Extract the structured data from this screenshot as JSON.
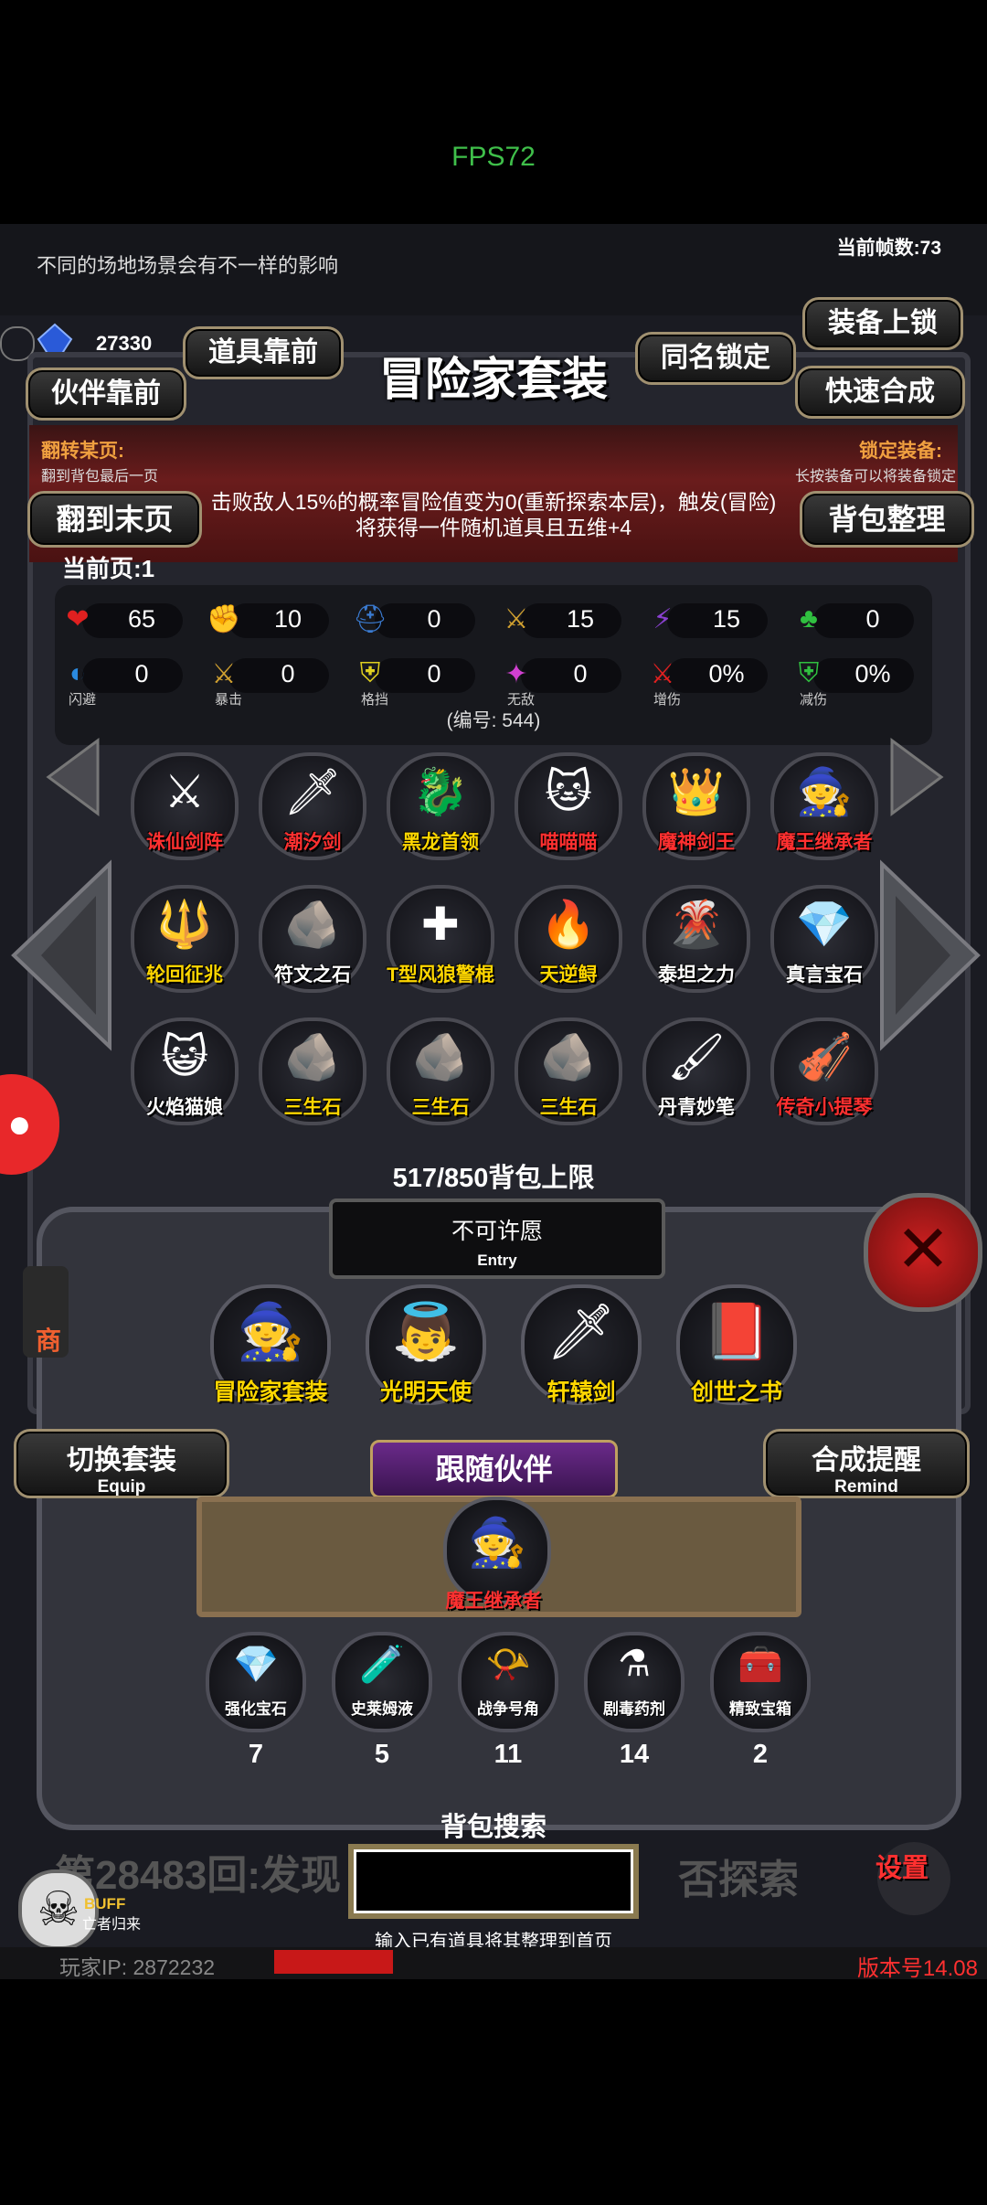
{
  "fps": "FPS72",
  "top_hint": "不同的场地场景会有不一样的影响",
  "frame_count": "当前帧数:73",
  "currency": "27330",
  "buttons": {
    "items_front": "道具靠前",
    "partner_front": "伙伴靠前",
    "same_name_lock": "同名锁定",
    "equip_lock": "装备上锁",
    "quick_synth": "快速合成",
    "last_page": "翻到末页",
    "bag_sort": "背包整理",
    "switch_set": "切换套装",
    "switch_set_en": "Equip",
    "synth_remind": "合成提醒",
    "synth_remind_en": "Remind",
    "follow_partner": "跟随伙伴",
    "settings": "设置",
    "shop_partial": "商"
  },
  "panel_title": "冒险家套装",
  "flip_page_label": "翻转某页:",
  "flip_page_hint": "翻到背包最后一页",
  "lock_equip_label": "锁定装备:",
  "lock_equip_hint": "长按装备可以将装备锁定",
  "description": "击败敌人15%的概率冒险值变为0(重新探索本层)，触发(冒险)将获得一件随机道具且五维+4",
  "current_page": "当前页:1",
  "stats_row1": [
    {
      "icon": "heart-icon",
      "glyph": "❤",
      "color": "#e02020",
      "value": "65"
    },
    {
      "icon": "strength-icon",
      "glyph": "✊",
      "color": "#e8c020",
      "value": "10"
    },
    {
      "icon": "helmet-icon",
      "glyph": "⛑",
      "color": "#3a7ad0",
      "value": "0"
    },
    {
      "icon": "sword-icon",
      "glyph": "⚔",
      "color": "#d0a030",
      "value": "15"
    },
    {
      "icon": "magic-icon",
      "glyph": "⚡",
      "color": "#8a40d0",
      "value": "15"
    },
    {
      "icon": "clover-icon",
      "glyph": "♣",
      "color": "#30c040",
      "value": "0"
    }
  ],
  "stats_row2": [
    {
      "icon": "dodge-icon",
      "glyph": "◐",
      "color": "#2a8ae0",
      "value": "0",
      "label": "闪避"
    },
    {
      "icon": "crit-icon",
      "glyph": "⚔",
      "color": "#d0a030",
      "value": "0",
      "label": "暴击"
    },
    {
      "icon": "block-icon",
      "glyph": "⛨",
      "color": "#e0d020",
      "value": "0",
      "label": "格挡"
    },
    {
      "icon": "invincible-icon",
      "glyph": "✦",
      "color": "#d040d0",
      "value": "0",
      "label": "无敌"
    },
    {
      "icon": "damage-up-icon",
      "glyph": "⚔",
      "color": "#e02020",
      "value": "0%",
      "label": "增伤"
    },
    {
      "icon": "damage-reduce-icon",
      "glyph": "⛨",
      "color": "#30c040",
      "value": "0%",
      "label": "减伤"
    }
  ],
  "item_number": "(编号: 544)",
  "items": [
    {
      "name": "诛仙剑阵",
      "color": "#ff3030",
      "glyph": "⚔"
    },
    {
      "name": "潮汐剑",
      "color": "#ff3030",
      "glyph": "🗡"
    },
    {
      "name": "黑龙首领",
      "color": "#ffd700",
      "glyph": "🐉"
    },
    {
      "name": "喵喵喵",
      "color": "#ff3030",
      "glyph": "🐱"
    },
    {
      "name": "魔神剑王",
      "color": "#ff3030",
      "glyph": "👑"
    },
    {
      "name": "魔王继承者",
      "color": "#ff3030",
      "glyph": "🧙"
    },
    {
      "name": "轮回征兆",
      "color": "#ffd700",
      "glyph": "🔱"
    },
    {
      "name": "符文之石",
      "color": "#ffffff",
      "glyph": "🪨"
    },
    {
      "name": "T型风狼警棍",
      "color": "#ffd700",
      "glyph": "✚"
    },
    {
      "name": "天逆鲟",
      "color": "#ffd700",
      "glyph": "🔥"
    },
    {
      "name": "泰坦之力",
      "color": "#ffffff",
      "glyph": "🌋"
    },
    {
      "name": "真言宝石",
      "color": "#ffffff",
      "glyph": "💎"
    },
    {
      "name": "火焰猫娘",
      "color": "#ffffff",
      "glyph": "😺"
    },
    {
      "name": "三生石",
      "color": "#ffd700",
      "glyph": "🪨"
    },
    {
      "name": "三生石",
      "color": "#ffd700",
      "glyph": "🪨"
    },
    {
      "name": "三生石",
      "color": "#ffd700",
      "glyph": "🪨"
    },
    {
      "name": "丹青妙笔",
      "color": "#ffffff",
      "glyph": "🖌"
    },
    {
      "name": "传奇小提琴",
      "color": "#ff3030",
      "glyph": "🎻"
    }
  ],
  "bag_limit": "517/850背包上限",
  "wish_text": "不可许愿",
  "wish_en": "Entry",
  "equipped": [
    {
      "name": "冒险家套装",
      "glyph": "🧙"
    },
    {
      "name": "光明天使",
      "glyph": "👼"
    },
    {
      "name": "轩辕剑",
      "glyph": "🗡"
    },
    {
      "name": "创世之书",
      "glyph": "📕"
    }
  ],
  "partner_name": "魔王继承者",
  "consumables": [
    {
      "name": "强化宝石",
      "count": "7",
      "glyph": "💎"
    },
    {
      "name": "史莱姆液",
      "count": "5",
      "glyph": "🧪"
    },
    {
      "name": "战争号角",
      "count": "11",
      "glyph": "📯"
    },
    {
      "name": "剧毒药剂",
      "count": "14",
      "glyph": "⚗"
    },
    {
      "name": "精致宝箱",
      "count": "2",
      "glyph": "🧰"
    }
  ],
  "search_title": "背包搜索",
  "search_hint": "输入已有道具将其整理到首页",
  "log_text_left": "第28483回:发现",
  "log_text_right": "否探索",
  "buff_label": "BUFF",
  "buff_sub": "亡者归来",
  "player_ip": "玩家IP: 2872232",
  "version": "版本号14.08"
}
